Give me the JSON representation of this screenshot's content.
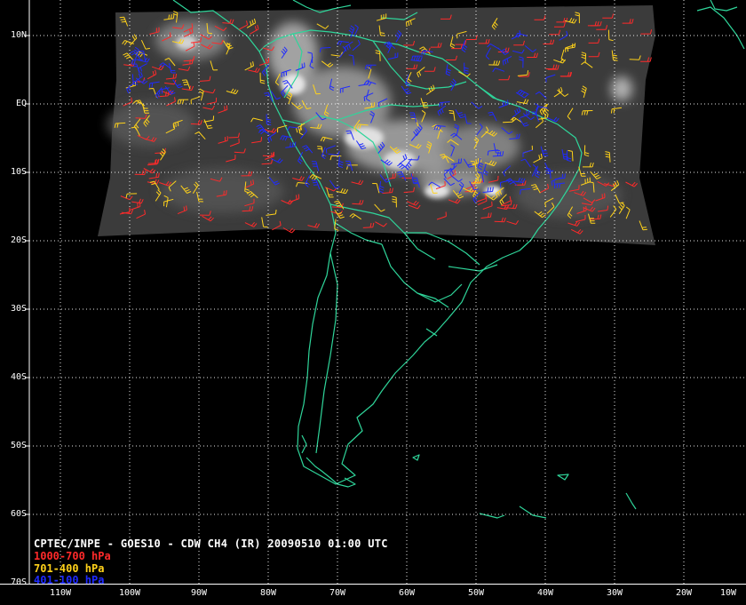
{
  "map": {
    "title": "CPTEC/INPE - GOES10 - CDW CH4 (IR) 20090510 01:00 UTC",
    "legend": [
      {
        "label": "1000-700 hPa",
        "color": "#ff2a2a"
      },
      {
        "label": "701-400 hPa",
        "color": "#ffd21a"
      },
      {
        "label": "401-100 hPa",
        "color": "#1f2bff"
      }
    ],
    "lat_labels": [
      "10N",
      "EQ",
      "10S",
      "20S",
      "30S",
      "40S",
      "50S",
      "60S",
      "70S"
    ],
    "lon_labels": [
      "110W",
      "100W",
      "90W",
      "80W",
      "70W",
      "60W",
      "50W",
      "40W",
      "30W",
      "20W",
      "10W"
    ],
    "colors": {
      "background": "#000000",
      "coastline": "#2fd59a",
      "grid": "#ffffff",
      "imagery": "#3a3a3a"
    }
  }
}
